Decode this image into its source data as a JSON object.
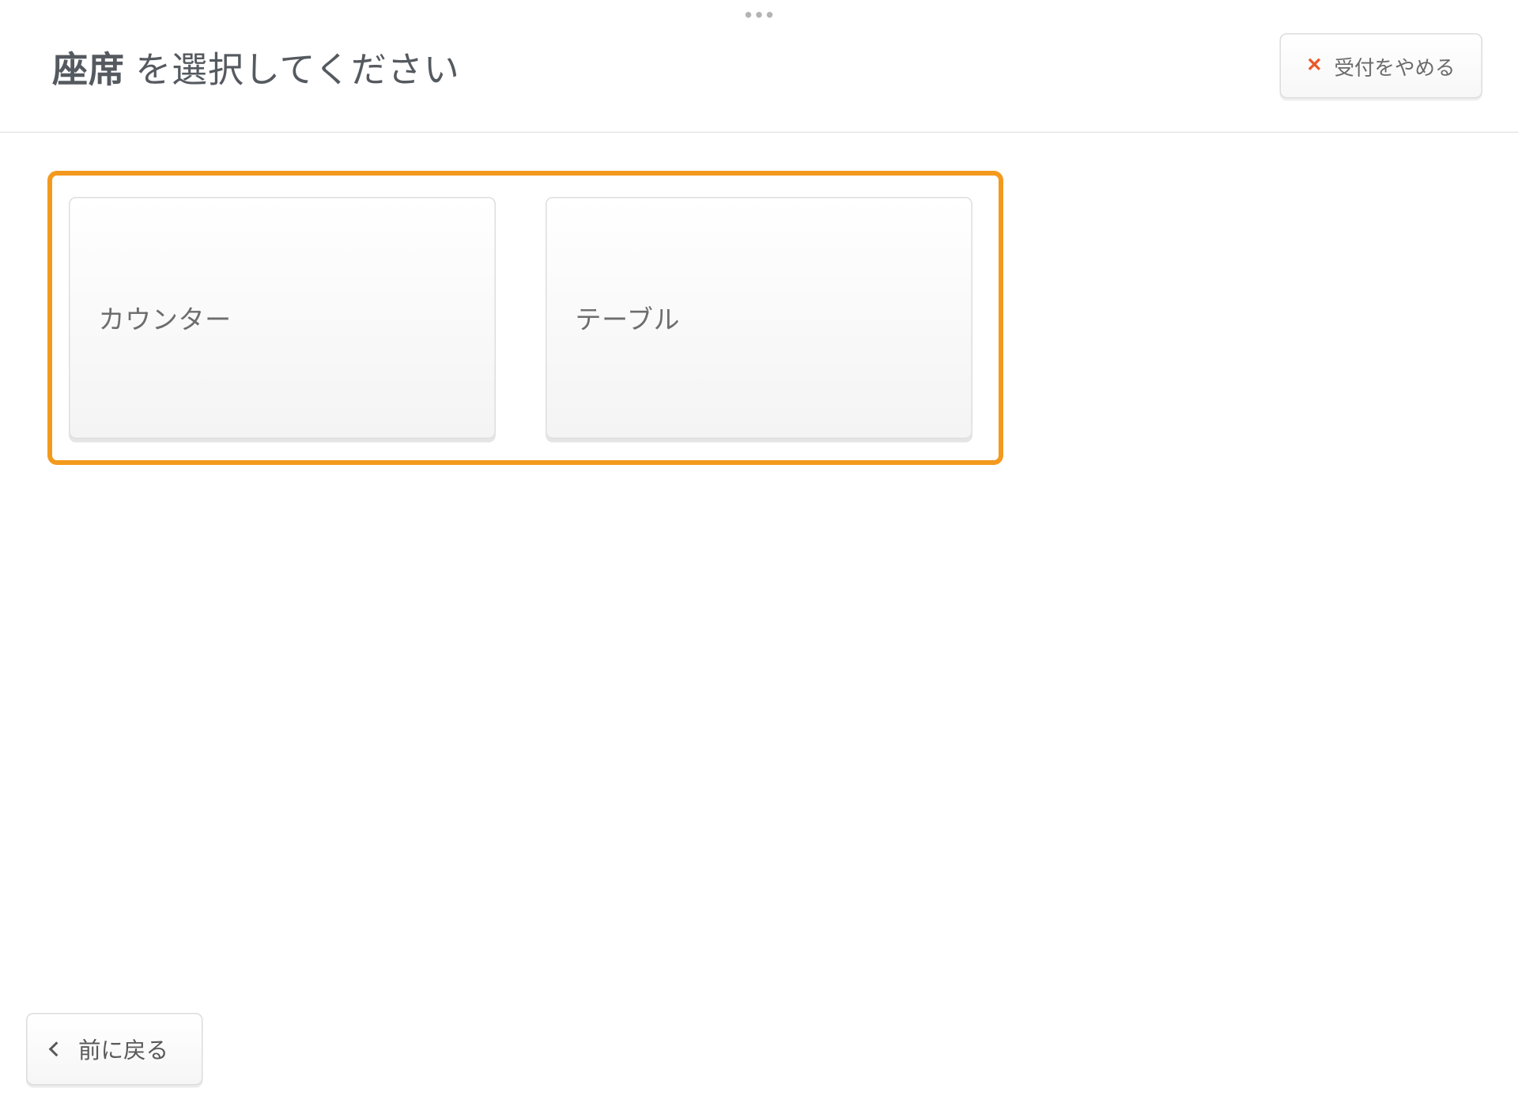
{
  "header": {
    "title_bold": "座席",
    "title_rest": " を選択してください",
    "cancel_label": "受付をやめる"
  },
  "options": [
    {
      "label": "カウンター"
    },
    {
      "label": "テーブル"
    }
  ],
  "footer": {
    "back_label": "前に戻る"
  }
}
